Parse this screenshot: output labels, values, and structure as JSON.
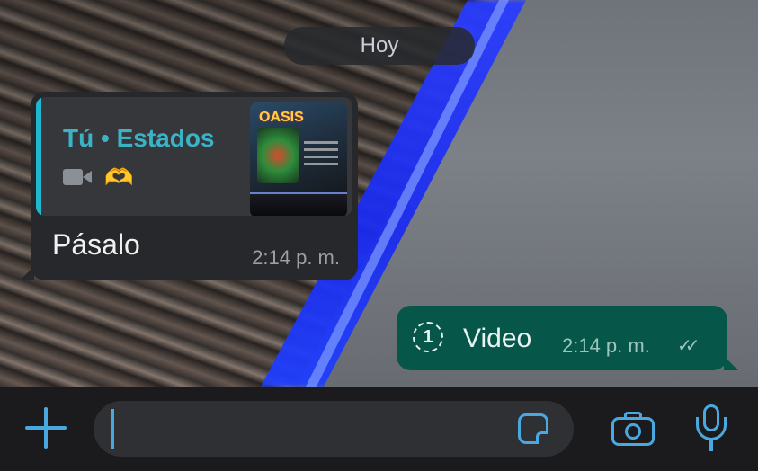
{
  "date_chip": {
    "label": "Hoy"
  },
  "incoming_message": {
    "quote": {
      "author": "Tú • Estados",
      "media_icon": "video-camera-icon",
      "emoji_icon": "heart-hands-icon",
      "emoji": "🫶",
      "thumbnail_title": "OASIS"
    },
    "text": "Pásalo",
    "time": "2:14 p. m."
  },
  "outgoing_message": {
    "icon": "view-once-icon",
    "icon_glyph": "1",
    "text": "Video",
    "time": "2:14 p. m.",
    "status_icon": "double-check-icon",
    "status_glyph": "✓✓"
  },
  "input_bar": {
    "attach_icon": "plus-icon",
    "sticker_icon": "sticker-icon",
    "camera_icon": "camera-icon",
    "mic_icon": "microphone-icon"
  },
  "colors": {
    "accent": "#4aa8e0",
    "incoming_bubble": "#26282b",
    "outgoing_bubble": "#06564a",
    "quote_author": "#3bb3c7"
  }
}
